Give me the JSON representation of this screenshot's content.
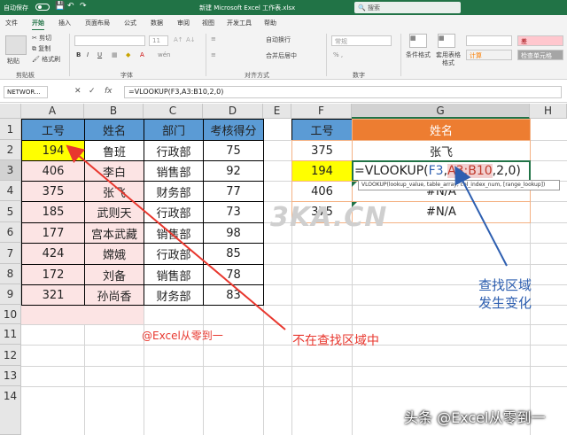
{
  "titlebar": {
    "autosave": "自动保存",
    "save": "💾",
    "undo": "↶",
    "redo": "↷",
    "title": "新建 Microsoft Excel 工作表.xlsx",
    "search": "🔍 搜索"
  },
  "tabs": [
    "文件",
    "开始",
    "插入",
    "页面布局",
    "公式",
    "数据",
    "审阅",
    "视图",
    "开发工具",
    "帮助"
  ],
  "ribbon": {
    "paste": "粘贴",
    "cut": "✂ 剪切",
    "copy": "⧉ 复制",
    "format_painter": "🖌 格式刷",
    "clipboard": "剪贴板",
    "font_size": "11",
    "bold": "B",
    "italic": "I",
    "underline": "U",
    "wen": "wén",
    "font": "字体",
    "wrap": "自动换行",
    "merge": "合并后居中",
    "align": "对齐方式",
    "general": "常规",
    "percent": "% ,",
    "number": "数字",
    "cond_format": "条件格式",
    "table_format": "套用表格格式",
    "calc": "计算",
    "bad": "差",
    "check_cell": "检查单元格",
    "align_icon": "≡",
    "format_icon": "▦"
  },
  "formula": {
    "name_box": "NETWOR...",
    "cancel": "✕",
    "enter": "✓",
    "fx": "fx",
    "content": "=VLOOKUP(F3,A3:B10,2,0)"
  },
  "cols": [
    "A",
    "B",
    "C",
    "D",
    "E",
    "F",
    "G",
    "H"
  ],
  "rows": [
    "1",
    "2",
    "3",
    "4",
    "5",
    "6",
    "7",
    "8",
    "9",
    "10",
    "11",
    "12",
    "13",
    "14"
  ],
  "table": {
    "headers": [
      "工号",
      "姓名",
      "部门",
      "考核得分"
    ],
    "rows": [
      [
        "194",
        "鲁班",
        "行政部",
        "75"
      ],
      [
        "406",
        "李白",
        "销售部",
        "92"
      ],
      [
        "375",
        "张飞",
        "财务部",
        "77"
      ],
      [
        "185",
        "武则天",
        "行政部",
        "73"
      ],
      [
        "177",
        "宫本武藏",
        "销售部",
        "98"
      ],
      [
        "424",
        "嫦娥",
        "行政部",
        "85"
      ],
      [
        "172",
        "刘备",
        "销售部",
        "78"
      ],
      [
        "321",
        "孙尚香",
        "财务部",
        "83"
      ]
    ]
  },
  "lookup": {
    "headers": [
      "工号",
      "姓名"
    ],
    "rows": [
      [
        "375",
        "张飞"
      ],
      [
        "194",
        ""
      ],
      [
        "406",
        "#N/A"
      ],
      [
        "375",
        "#N/A"
      ]
    ],
    "formula_prefix": "=VLOOKUP(",
    "formula_ref1": "F3",
    "formula_comma": ",",
    "formula_ref2": "A3:B10",
    "formula_suffix": ",2,0)",
    "tooltip": "VLOOKUP(lookup_value, table_array, col_index_num, [range_lookup])"
  },
  "annotations": {
    "left": "@Excel从零到一",
    "red": "不在查找区域中",
    "blue_line1": "查找区域",
    "blue_line2": "发生变化",
    "watermark": "3KA.CN",
    "footer": "头条 @Excel从零到一"
  },
  "colors": {
    "excel_green": "#217346",
    "header_blue": "#5b9bd5",
    "header_orange": "#ed7d31",
    "highlight_yellow": "#ffff00",
    "pink_area": "#fce4e4",
    "arrow_red": "#e8372e",
    "arrow_blue": "#2e5fb0"
  }
}
